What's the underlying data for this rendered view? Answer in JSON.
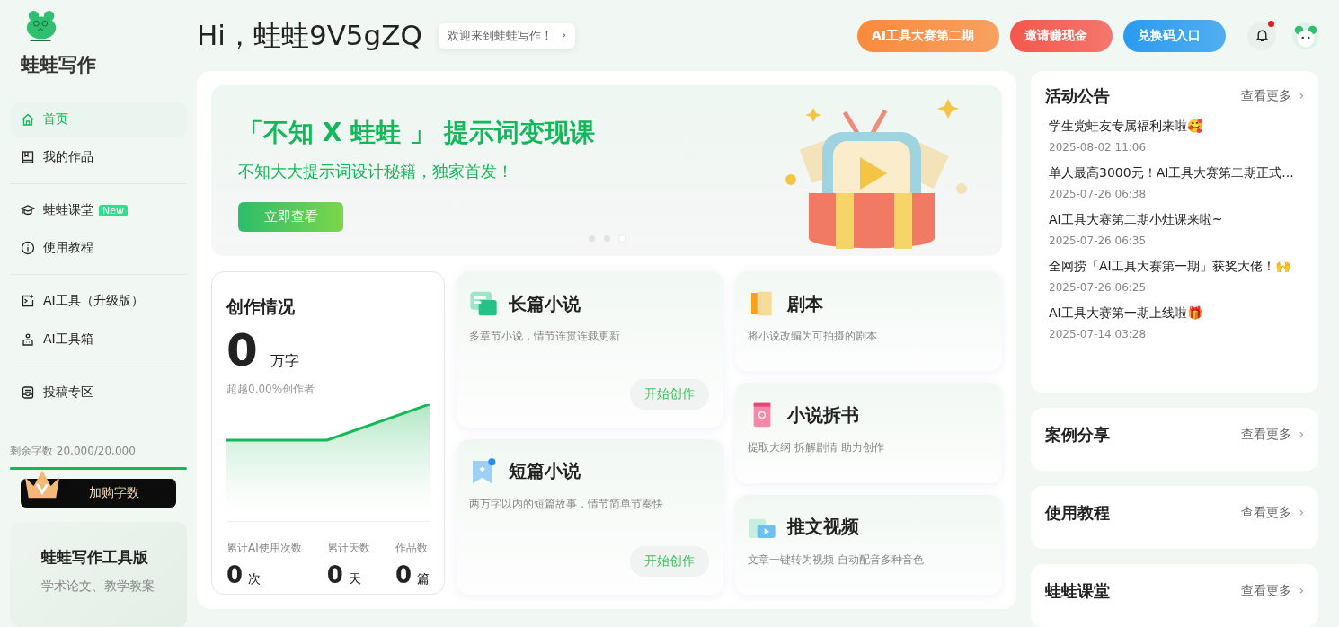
{
  "sidebar": {
    "brand": "蛙蛙写作",
    "items": [
      {
        "label": "首页",
        "selected": true
      },
      {
        "label": "我的作品",
        "selected": false
      },
      {
        "label": "蛙蛙课堂",
        "selected": false,
        "badge": "New"
      },
      {
        "label": "使用教程",
        "selected": false
      },
      {
        "label": "AI工具（升级版）",
        "selected": false
      },
      {
        "label": "AI工具箱",
        "selected": false
      },
      {
        "label": "投稿专区",
        "selected": false
      }
    ],
    "quota": {
      "label": "剩余字数 20,000/20,000",
      "level": 1
    },
    "buy_button": "加购字数",
    "promo": {
      "title": "蛙蛙写作工具版",
      "text": "学术论文、教学教案"
    }
  },
  "header": {
    "greeting": "Hi，蛙蛙9V5gZQ",
    "welcome": "欢迎来到蛙蛙写作！",
    "welcome_arrow": "›",
    "promos": [
      {
        "label": "AI工具大赛第二期",
        "color": "#fa8a3c"
      },
      {
        "label": "邀请赚现金",
        "color": "#f4574c"
      },
      {
        "label": "兑换码入口",
        "color": "#2a9bf0"
      }
    ],
    "notifications_unread": true
  },
  "banner": {
    "title": "「不知 X 蛙蛙 」 提示词变现课",
    "subtitle": "不知大大提示词设计秘籍，独家首发！",
    "button": "立即查看",
    "dots": [
      {
        "selected": false
      },
      {
        "selected": false
      },
      {
        "selected": true
      }
    ]
  },
  "stats": {
    "title": "创作情况",
    "words": "0",
    "words_unit": "万字",
    "rank": "超越0.00%创作者",
    "metrics": [
      {
        "label": "累计AI使用次数",
        "value": "0",
        "unit": "次"
      },
      {
        "label": "累计天数",
        "value": "0",
        "unit": "天"
      },
      {
        "label": "作品数",
        "value": "0",
        "unit": "篇"
      }
    ]
  },
  "tools": [
    {
      "kind": "large",
      "title": "长篇小说",
      "desc": "多章节小说，情节连贯连载更新",
      "button": "开始创作"
    },
    {
      "kind": "large",
      "title": "短篇小说",
      "desc": "两万字以内的短篇故事，情节简单节奏快",
      "button": "开始创作"
    },
    {
      "kind": "small",
      "title": "剧本",
      "desc": "将小说改编为可拍摄的剧本"
    },
    {
      "kind": "small",
      "title": "小说拆书",
      "desc": "提取大纲 拆解剧情 助力创作"
    },
    {
      "kind": "small",
      "title": "推文视频",
      "desc": "文章一键转为视频 自动配音多种音色"
    }
  ],
  "right": {
    "notices_title": "活动公告",
    "notices_more": "查看更多",
    "notices_more_arrow": "›",
    "notices": [
      {
        "title": "学生党蛙友专属福利来啦🥰",
        "time": "2025-08-02 11:06"
      },
      {
        "title": "单人最高3000元！AI工具大赛第二期正式...",
        "time": "2025-07-26 06:38"
      },
      {
        "title": "AI工具大赛第二期小灶课来啦~",
        "time": "2025-07-26 06:35"
      },
      {
        "title": "全网捞「AI工具大赛第一期」获奖大佬！🙌",
        "time": "2025-07-26 06:25"
      },
      {
        "title": "AI工具大赛第一期上线啦🎁",
        "time": "2025-07-14 03:28"
      }
    ],
    "sections": [
      {
        "title": "案例分享",
        "more": "查看更多",
        "more_arrow": "›"
      },
      {
        "title": "使用教程",
        "more": "查看更多",
        "more_arrow": "›"
      },
      {
        "title": "蛙蛙课堂",
        "more": "查看更多",
        "more_arrow": "›"
      }
    ]
  }
}
